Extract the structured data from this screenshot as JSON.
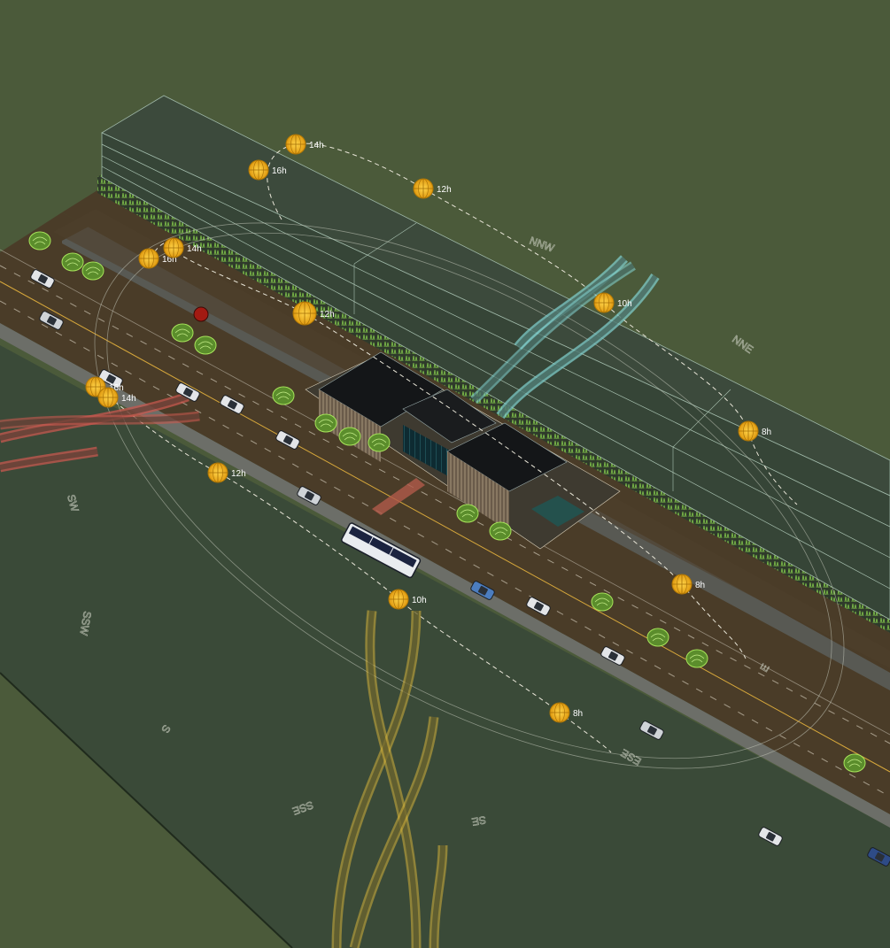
{
  "colors": {
    "background": "#4b5a3a",
    "ground": "#3a4a38",
    "road": "#4a3c28",
    "sidewalk": "#585a56",
    "building_block": "#3a4a38",
    "sun": "#f2b51c",
    "wind_cold": "#7ecbc8",
    "wind_warm": "#c8584f",
    "wind_south": "#d5b33a",
    "tree": "#7fc24a"
  },
  "sun_paths": [
    {
      "name": "sun-path-north",
      "markers": [
        {
          "label": "16h"
        },
        {
          "label": "14h"
        },
        {
          "label": "12h"
        },
        {
          "label": "10h"
        },
        {
          "label": "8h"
        }
      ]
    },
    {
      "name": "sun-path-middle",
      "markers": [
        {
          "label": "16h"
        },
        {
          "label": "14h"
        },
        {
          "label": "12h"
        },
        {
          "label": "8h"
        }
      ]
    },
    {
      "name": "sun-path-south",
      "markers": [
        {
          "label": "16h"
        },
        {
          "label": "14h"
        },
        {
          "label": "12h"
        },
        {
          "label": "10h"
        },
        {
          "label": "8h"
        }
      ]
    }
  ],
  "compass": [
    {
      "label": "NNW"
    },
    {
      "label": "NNE"
    },
    {
      "label": "E"
    },
    {
      "label": "ESE"
    },
    {
      "label": "SE"
    },
    {
      "label": "SSE"
    },
    {
      "label": "S"
    },
    {
      "label": "SSW"
    },
    {
      "label": "SW"
    }
  ],
  "wind": {
    "cold": "north-east wind",
    "warm": "west wind",
    "south": "south wind"
  },
  "icons": [
    "sun-icon",
    "car-icon",
    "bus-icon",
    "tree-icon",
    "wind-arrow-icon"
  ]
}
